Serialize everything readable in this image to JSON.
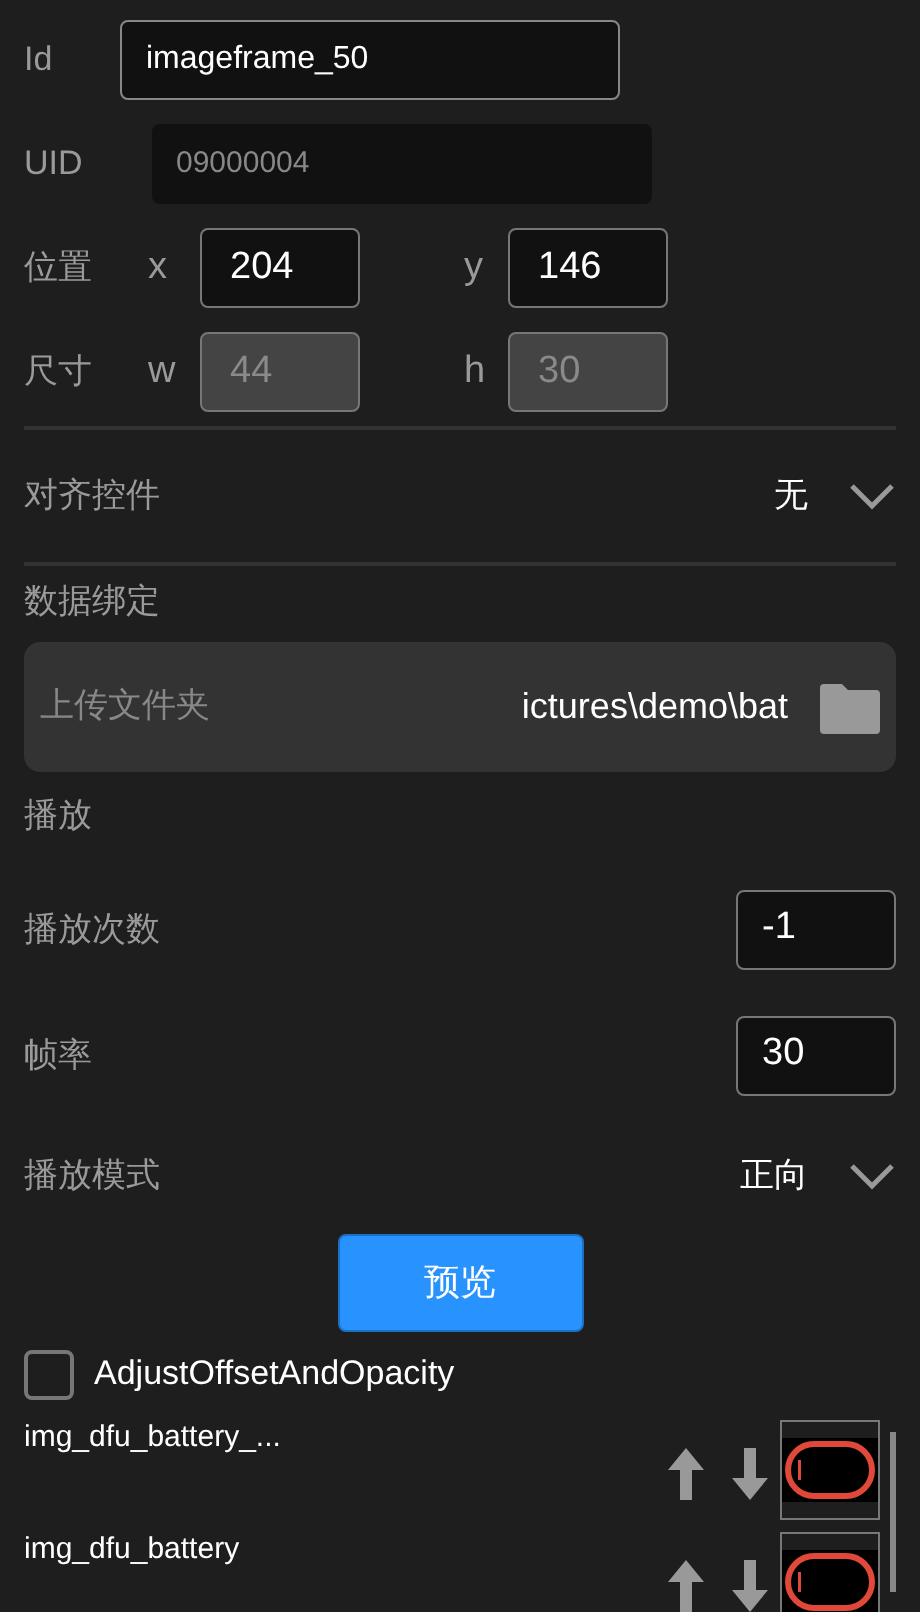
{
  "id_field": {
    "label": "Id",
    "value": "imageframe_50"
  },
  "uid_field": {
    "label": "UID",
    "value": "09000004",
    "disabled": true
  },
  "position": {
    "label": "位置",
    "x": {
      "label": "x",
      "value": "204",
      "disabled": false
    },
    "y": {
      "label": "y",
      "value": "146",
      "disabled": false
    }
  },
  "size": {
    "label": "尺寸",
    "w": {
      "label": "w",
      "value": "44",
      "disabled": true
    },
    "h": {
      "label": "h",
      "value": "30",
      "disabled": true
    }
  },
  "align": {
    "label": "对齐控件",
    "value": "无"
  },
  "data_binding": {
    "title": "数据绑定",
    "label": "上传文件夹",
    "path": "ictures\\demo\\bat"
  },
  "playback": {
    "title": "播放",
    "fields": [
      {
        "label": "播放次数",
        "value": "-1"
      },
      {
        "label": "帧率",
        "value": "30"
      }
    ],
    "mode": {
      "label": "播放模式",
      "value": "正向"
    }
  },
  "preview_button": "预览",
  "checkbox": {
    "label": "AdjustOffsetAndOpacity",
    "checked": false
  },
  "images": [
    {
      "name": "img_dfu_battery_..."
    },
    {
      "name": "img_dfu_battery"
    }
  ]
}
